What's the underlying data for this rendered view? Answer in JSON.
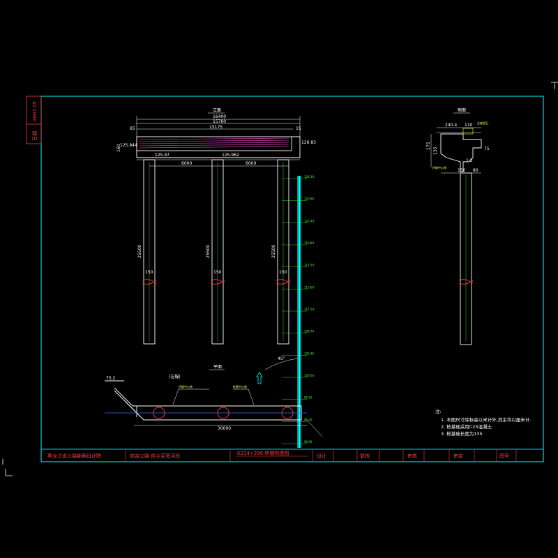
{
  "colors": {
    "background": "#000000",
    "frame": "#00ffff",
    "structure": "#ffffff",
    "rebar": "#3cff3c",
    "cut_mark": "#ff3b3b",
    "pile": "#00e5ff",
    "title_text": "#ff3b3b"
  },
  "side_strip": {
    "date_value": "2007.05",
    "date_label": "日期"
  },
  "elevation": {
    "title": "立面",
    "dims": {
      "overall": "16400",
      "span_top": "15760",
      "cap_length": "15175",
      "span_left": "6000",
      "span_right": "6000",
      "pile_len_left": "25500",
      "pile_len_mid": "25500",
      "pile_len_right": "25500",
      "dia_left": "150",
      "dia_mid": "150",
      "dia_right": "150",
      "cap_top_elev": "126.83",
      "cap_bot_elev": "125.844",
      "bearing_left": "125.97",
      "bearing_mid": "125.962",
      "cap_height": "160",
      "left_edge": "65",
      "right_edge": "15"
    }
  },
  "section": {
    "title": "侧面",
    "dims": {
      "top_width": "240.4",
      "top_right": "110",
      "left_h": "175",
      "mid_h": "135",
      "right_h": "75",
      "bottom_w": "150",
      "step": "1:2",
      "bottom_right": "80"
    },
    "labels": {
      "pad": "支座垫石",
      "stem": "桥墩中心线"
    }
  },
  "plan": {
    "title": "平面",
    "subtitle": "(左幅)",
    "labels": {
      "left_line": "桥墩中心线",
      "right_line": "桩基中心线"
    },
    "dims": {
      "skew": "75.2",
      "overall": "30000",
      "angle": "45°"
    }
  },
  "elevation_scale": {
    "marks": [
      "124.30",
      "123.60",
      "122.40",
      "119.80",
      "117.50",
      "113.60",
      "111.50",
      "108.70",
      "102.40",
      "101.60",
      "99.10",
      "98.30",
      "96.50"
    ]
  },
  "notes": {
    "heading": "注:",
    "items": [
      "1. 本图尺寸除标高以米计外,其余均以厘米计.",
      "2. 桩基础采用C25混凝土.",
      "3. 桩基础长度为135."
    ]
  },
  "title_block": {
    "company": "黑龙江省公路勘察设计院",
    "project": "依吉公路  依兰至宽河段",
    "drawing": "K214+290  桥墩构造图",
    "design_label": "设计",
    "review_label": "复核",
    "check_label": "审核",
    "approve_label": "审定",
    "number_label": "图号"
  }
}
